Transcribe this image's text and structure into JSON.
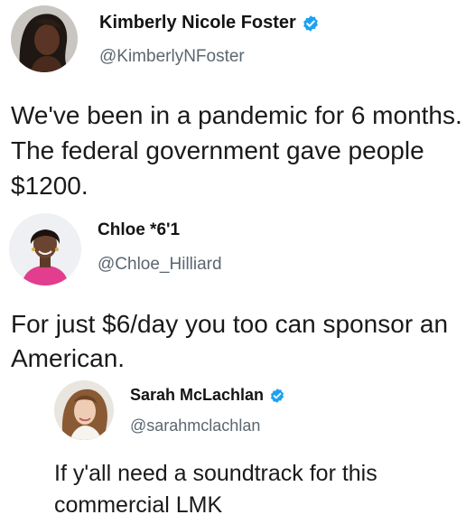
{
  "tweets": [
    {
      "name": "Kimberly Nicole Foster",
      "verified": true,
      "handle": "@KimberlyNFoster",
      "text": "We've been in a pandemic for 6 months. The federal government gave people $1200.",
      "avatar_icon": "profile-photo"
    },
    {
      "name": "Chloe *6'1",
      "verified": false,
      "handle": "@Chloe_Hilliard",
      "text": "For just $6/day you too can sponsor an American.",
      "avatar_icon": "profile-photo"
    },
    {
      "name": "Sarah McLachlan",
      "verified": true,
      "handle": "@sarahmclachlan",
      "text": "If y'all need a soundtrack for this commercial LMK",
      "avatar_icon": "profile-photo"
    }
  ],
  "colors": {
    "verified_badge": "#1da1f2",
    "handle_text": "#5b6670",
    "body_text": "#1a1a1a"
  }
}
